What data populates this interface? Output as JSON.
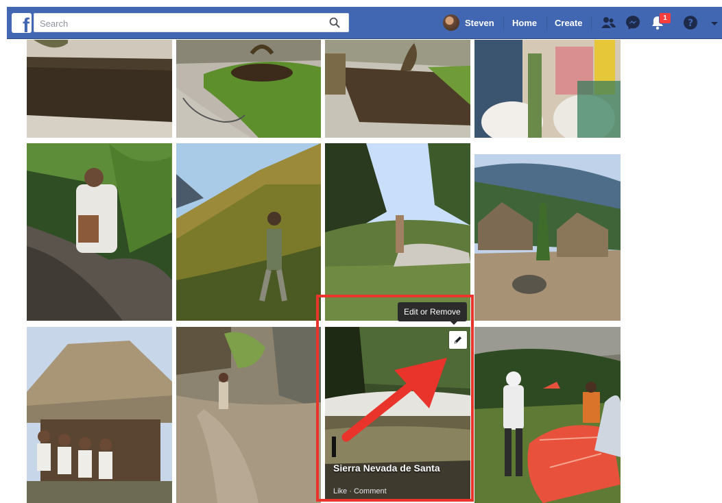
{
  "header": {
    "search_placeholder": "Search",
    "user_name": "Steven",
    "nav_home": "Home",
    "nav_create": "Create",
    "notification_count": "1",
    "brand_color": "#4267b2"
  },
  "photo_overlay": {
    "tooltip": "Edit or Remove",
    "caption": "Sierra Nevada de Santa",
    "like_label": "Like",
    "separator": " · ",
    "comment_label": "Comment",
    "highlight_color": "#e8342a"
  },
  "icons": [
    "facebook-logo-icon",
    "search-icon",
    "friends-icon",
    "messenger-icon",
    "notifications-icon",
    "help-icon",
    "caret-down-icon",
    "pencil-icon"
  ]
}
